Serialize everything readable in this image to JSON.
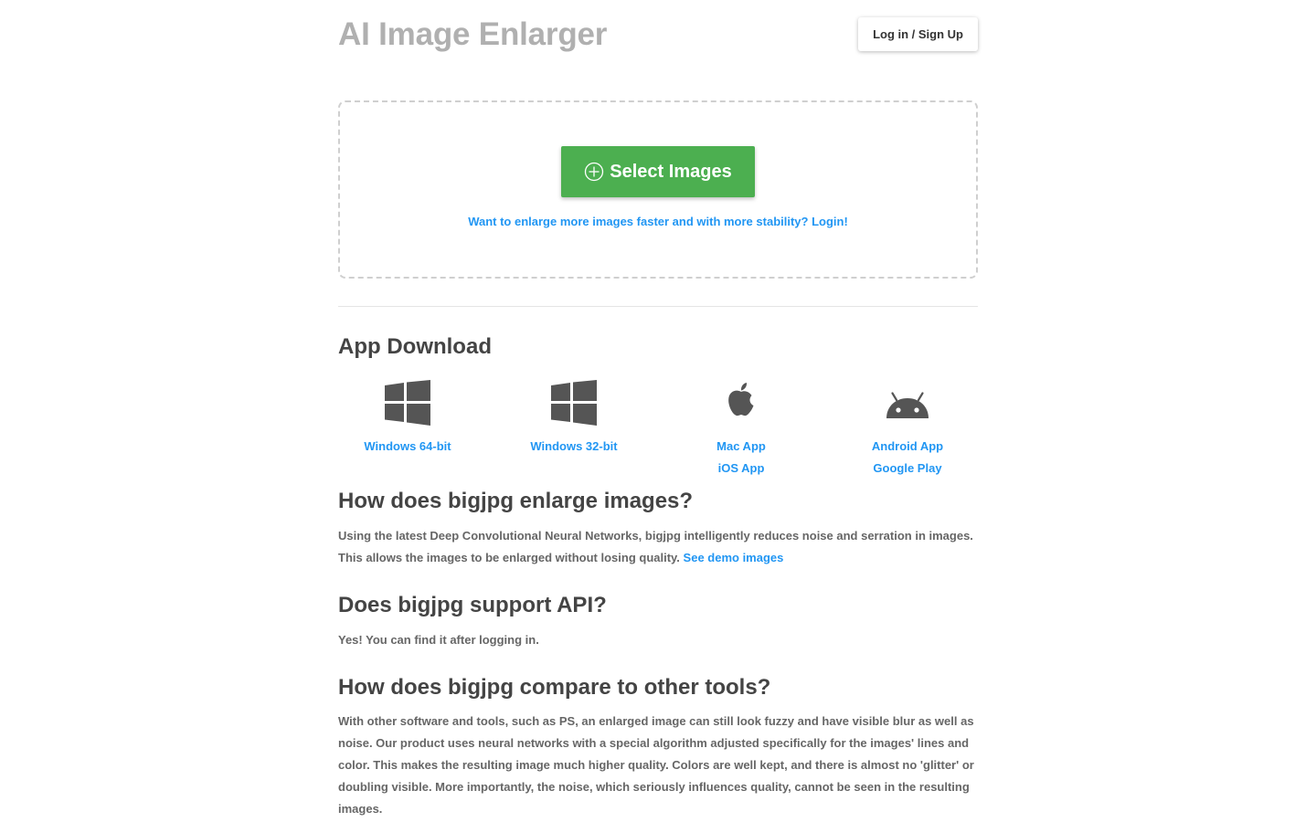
{
  "header": {
    "title": "AI Image Enlarger",
    "login_label": "Log in / Sign Up"
  },
  "upload": {
    "select_label": "Select Images",
    "login_hint": "Want to enlarge more images faster and with more stability? Login!"
  },
  "apps": {
    "heading": "App Download",
    "items": [
      {
        "icon": "windows-icon",
        "links": [
          "Windows 64-bit"
        ]
      },
      {
        "icon": "windows-icon",
        "links": [
          "Windows 32-bit"
        ]
      },
      {
        "icon": "apple-icon",
        "links": [
          "Mac App",
          "iOS App"
        ]
      },
      {
        "icon": "android-icon",
        "links": [
          "Android App",
          "Google Play"
        ]
      }
    ]
  },
  "faq": [
    {
      "question": "How does bigjpg enlarge images?",
      "answer": "Using the latest Deep Convolutional Neural Networks, bigjpg intelligently reduces noise and serration in images. This allows the images to be enlarged without losing quality.",
      "link": "See demo images"
    },
    {
      "question": "Does bigjpg support API?",
      "answer": "Yes! You can find it after logging in."
    },
    {
      "question": "How does bigjpg compare to other tools?",
      "answer": "With other software and tools, such as PS, an enlarged image can still look fuzzy and have visible blur as well as noise. Our product uses neural networks with a special algorithm adjusted specifically for the images' lines and color. This makes the resulting image much higher quality. Colors are well kept, and there is almost no 'glitter' or doubling visible. More importantly, the noise, which seriously influences quality, cannot be seen in the resulting images."
    }
  ],
  "colors": {
    "accent_green": "#4caf50",
    "link_blue": "#2196f3",
    "title_gray": "#b0b0b0",
    "icon_gray": "#555555"
  }
}
